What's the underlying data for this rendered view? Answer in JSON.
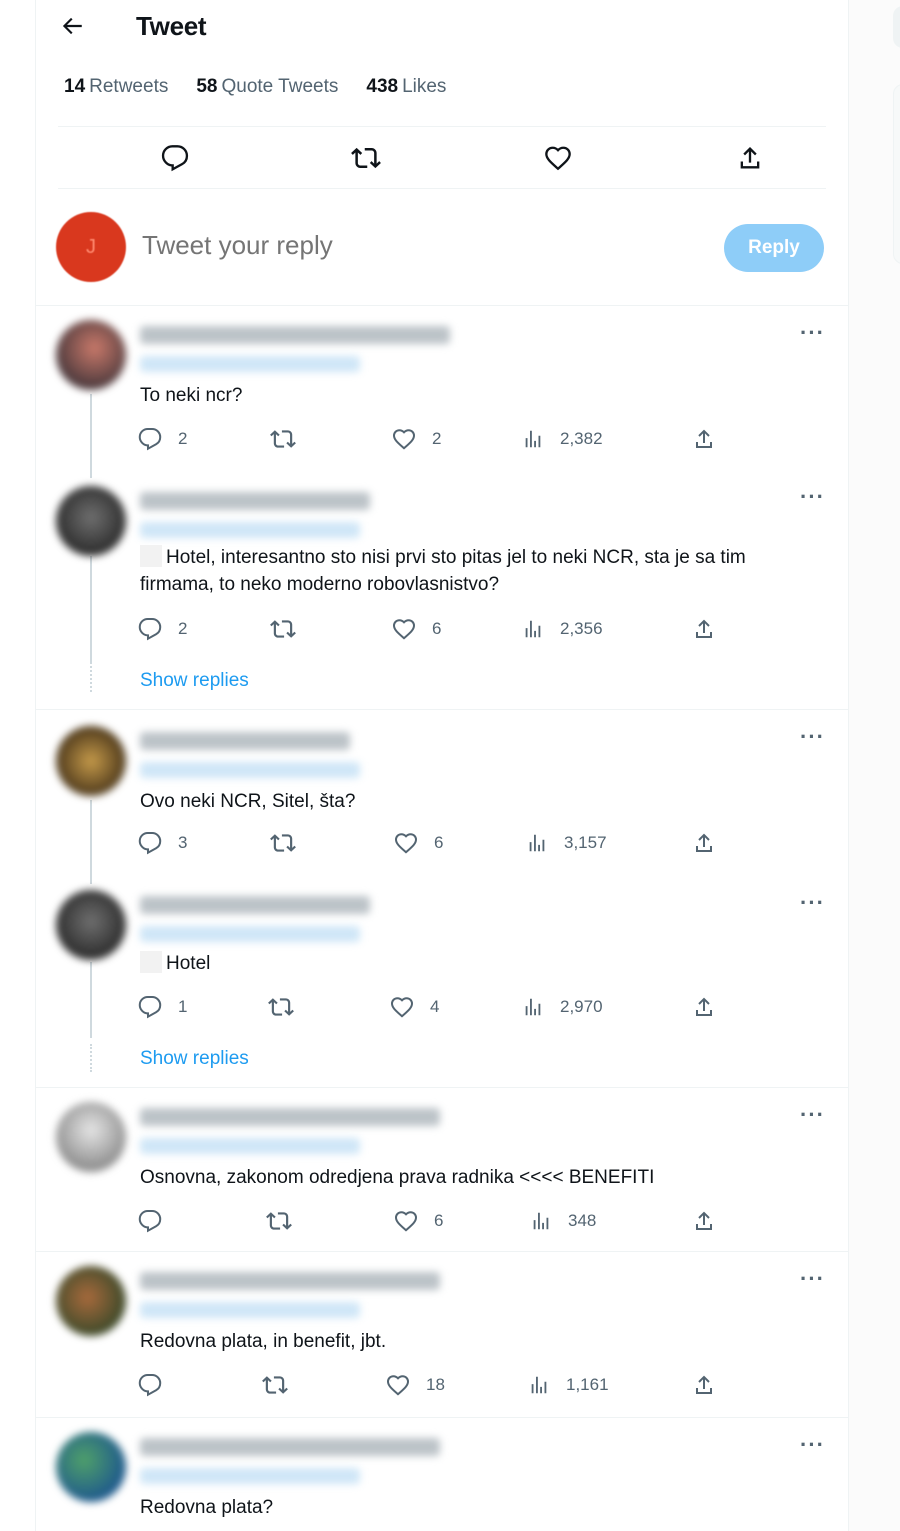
{
  "header": {
    "title": "Tweet"
  },
  "stats": [
    {
      "count": "14",
      "label": "Retweets"
    },
    {
      "count": "58",
      "label": "Quote Tweets"
    },
    {
      "count": "438",
      "label": "Likes"
    }
  ],
  "composer": {
    "placeholder": "Tweet your reply",
    "reply_label": "Reply",
    "avatar_letter": "J"
  },
  "more_label": "···",
  "show_replies_label": "Show replies",
  "replies": [
    {
      "text": "To neki ncr?",
      "replies": "2",
      "retweets": "",
      "likes": "2",
      "views": "2,382"
    },
    {
      "text": "Hotel, interesantno sto nisi prvi sto pitas jel to neki NCR, sta je sa tim firmama, to neko moderno robovlasnistvo?",
      "replies": "2",
      "retweets": "",
      "likes": "6",
      "views": "2,356"
    },
    {
      "text": "Ovo neki NCR, Sitel, šta?",
      "replies": "3",
      "retweets": "",
      "likes": "6",
      "views": "3,157"
    },
    {
      "text": "Hotel",
      "replies": "1",
      "retweets": "",
      "likes": "4",
      "views": "2,970"
    },
    {
      "text": "Osnovna, zakonom odredjena prava radnika  <<<< BENEFITI",
      "replies": "",
      "retweets": "",
      "likes": "6",
      "views": "348"
    },
    {
      "text": "Redovna plata, in benefit, jbt.",
      "replies": "",
      "retweets": "",
      "likes": "18",
      "views": "1,161"
    },
    {
      "text": "Redovna plata?",
      "replies": "",
      "retweets": "",
      "likes": "",
      "views": ""
    }
  ]
}
